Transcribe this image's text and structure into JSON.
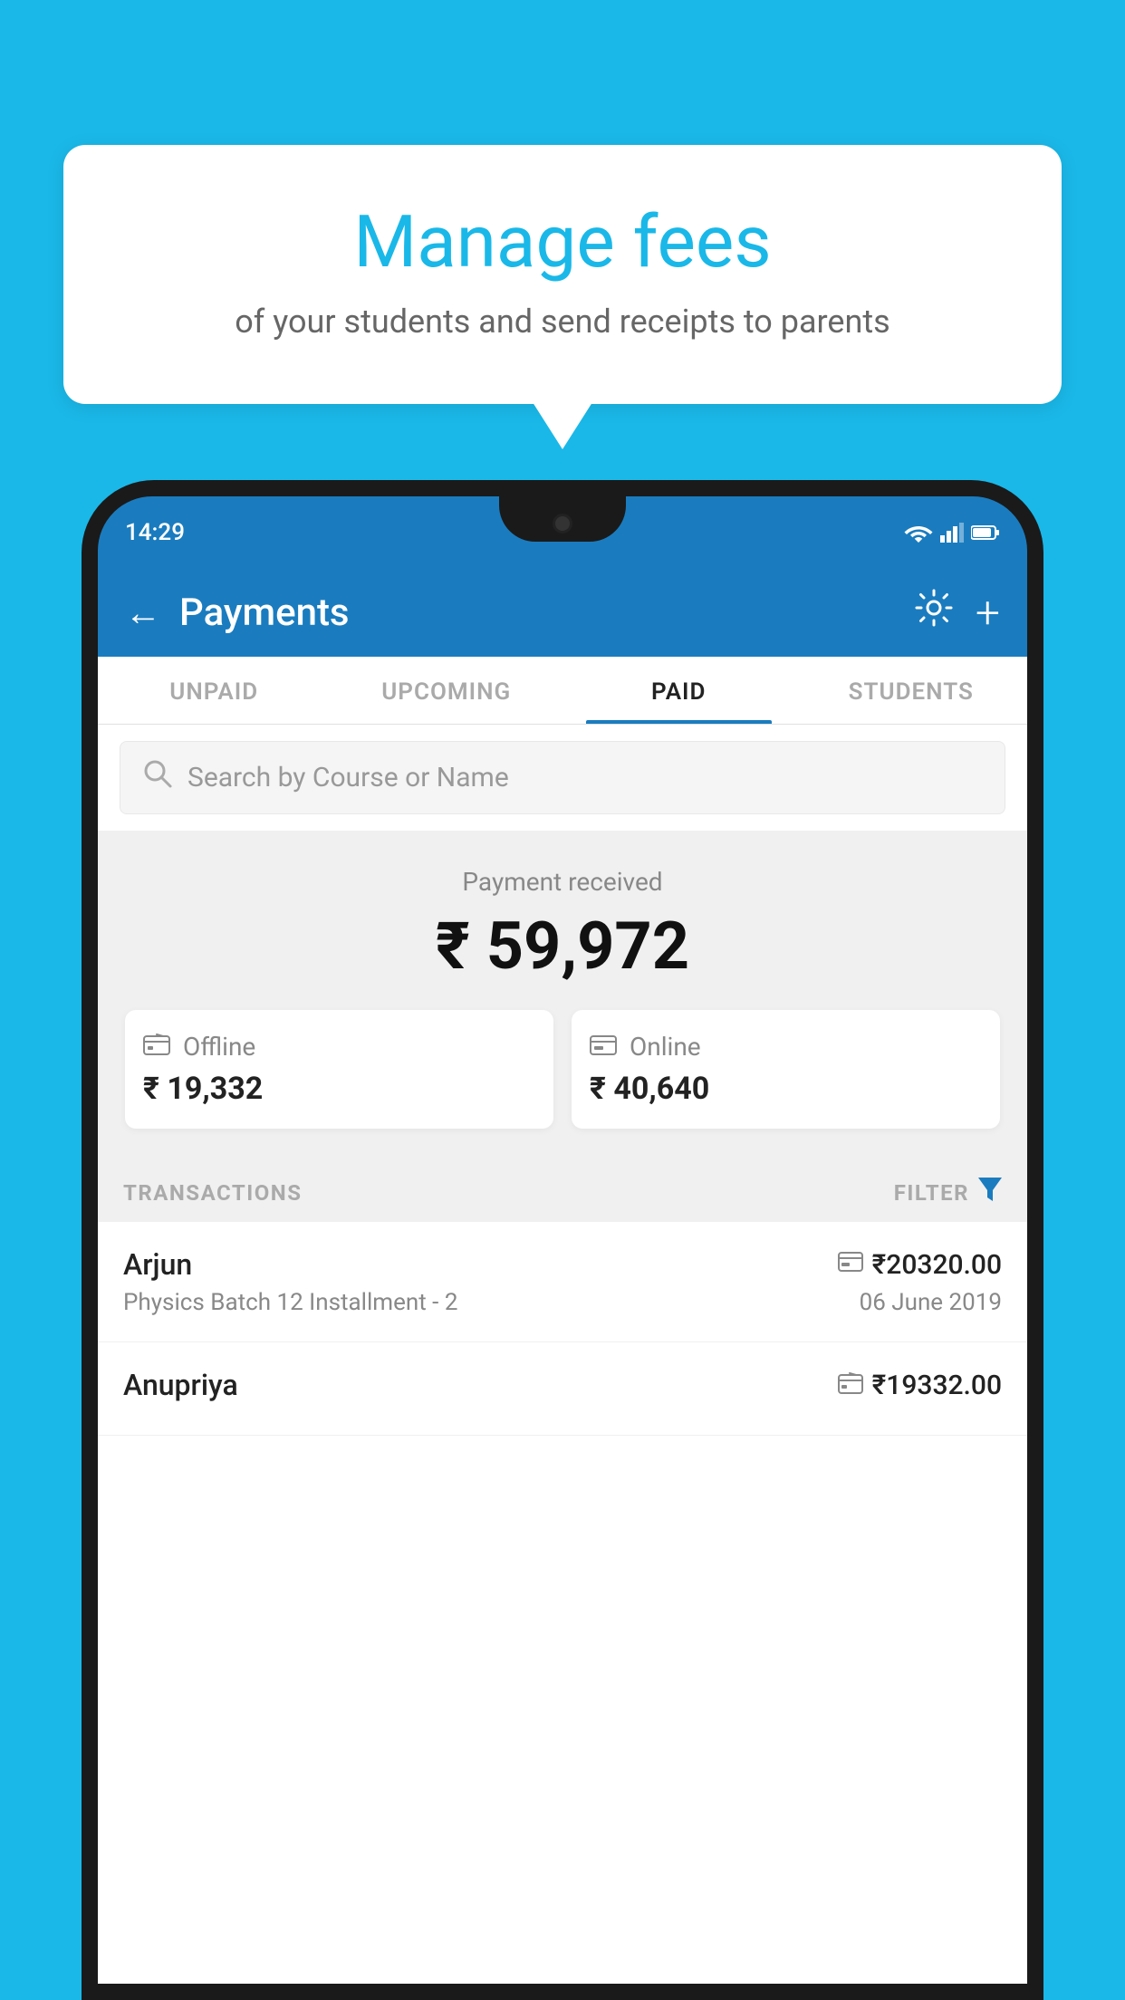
{
  "background_color": "#1ab8e8",
  "speech_bubble": {
    "title": "Manage fees",
    "subtitle": "of your students and send receipts to parents"
  },
  "status_bar": {
    "time": "14:29",
    "wifi": "▲",
    "signal": "▲",
    "battery": "▉"
  },
  "header": {
    "title": "Payments",
    "back_label": "←",
    "gear_label": "⚙",
    "plus_label": "+"
  },
  "tabs": [
    {
      "label": "UNPAID",
      "active": false
    },
    {
      "label": "UPCOMING",
      "active": false
    },
    {
      "label": "PAID",
      "active": true
    },
    {
      "label": "STUDENTS",
      "active": false
    }
  ],
  "search": {
    "placeholder": "Search by Course or Name"
  },
  "payment_summary": {
    "received_label": "Payment received",
    "total_amount": "₹ 59,972",
    "offline": {
      "label": "Offline",
      "amount": "₹ 19,332",
      "icon": "💳"
    },
    "online": {
      "label": "Online",
      "amount": "₹ 40,640",
      "icon": "💳"
    }
  },
  "transactions": {
    "section_label": "TRANSACTIONS",
    "filter_label": "FILTER",
    "items": [
      {
        "name": "Arjun",
        "amount": "₹20320.00",
        "course": "Physics Batch 12 Installment - 2",
        "date": "06 June 2019",
        "type": "online"
      },
      {
        "name": "Anupriya",
        "amount": "₹19332.00",
        "course": "",
        "date": "",
        "type": "offline"
      }
    ]
  }
}
